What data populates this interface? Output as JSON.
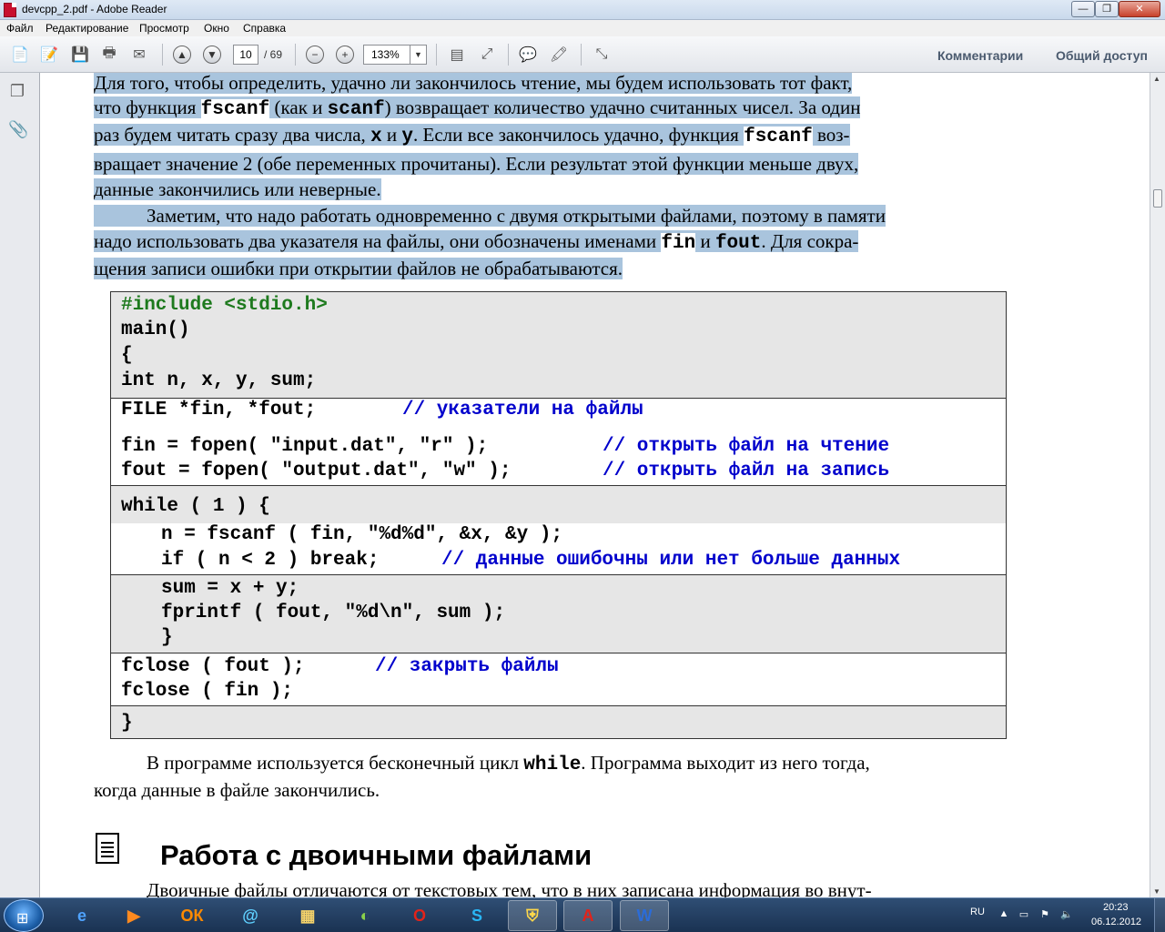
{
  "window": {
    "title": "devcpp_2.pdf - Adobe Reader"
  },
  "menu": [
    "Файл",
    "Редактирование",
    "Просмотр",
    "Окно",
    "Справка"
  ],
  "toolbar": {
    "page_current": "10",
    "page_total": "/ 69",
    "zoom": "133%",
    "comments_label": "Комментарии",
    "share_label": "Общий доступ"
  },
  "document": {
    "para1": [
      "Для того, чтобы определить, удачно ли закончилось чтение, мы будем использовать тот факт,",
      [
        "что функция ",
        "fscanf",
        " (как и ",
        "scanf",
        ") возвращает количество удачно считанных чисел. За один"
      ],
      [
        "раз будем читать сразу два числа, ",
        "x",
        " и ",
        "y",
        ". Если все закончилось удачно, функция ",
        "fscanf",
        " воз-"
      ],
      "вращает значение 2 (обе переменных прочитаны). Если результат этой функции меньше двух,",
      "данные закончились или неверные."
    ],
    "para2": [
      "Заметим, что надо работать одновременно с двумя открытыми файлами, поэтому в памяти",
      [
        "надо использовать два указателя на файлы, они обозначены именами ",
        "fin",
        " и ",
        "fout",
        ". Для сокра-"
      ],
      "щения записи ошибки при открытии файлов не обрабатываются."
    ],
    "code": {
      "include": "#include <stdio.h>",
      "main": "main()",
      "brace_open": "{",
      "decl": "int n, x, y, sum;",
      "file_decl": "FILE *fin, *fout;",
      "file_decl_comment": "// указатели на файлы",
      "fopen_in": "fin = fopen( \"input.dat\", \"r\" );",
      "fopen_in_comment": "// открыть файл на чтение",
      "fopen_out": "fout = fopen( \"output.dat\", \"w\" );",
      "fopen_out_comment": "// открыть файл на запись",
      "while": "while ( 1 ) {",
      "fscanf": "n = fscanf ( fin, \"%d%d\", &x, &y );",
      "if_break": "if ( n < 2 ) break;",
      "if_break_comment": "// данные ошибочны или нет больше данных",
      "sum": "sum = x + y;",
      "fprintf": "fprintf ( fout, \"%d\\n\", sum );",
      "while_close": "}",
      "fclose_out": "fclose ( fout );",
      "fclose_out_comment": "// закрыть файлы",
      "fclose_in": "fclose ( fin );",
      "brace_close": "}"
    },
    "para3": [
      [
        "В программе используется бесконечный цикл ",
        "while",
        ". Программа выходит из него тогда,"
      ],
      "когда данные в файле закончились."
    ],
    "heading": "Работа с двоичными файлами",
    "para4_partial": "Двоичные файлы отличаются от текстовых тем, что в них записана информация во внут-"
  },
  "taskbar": {
    "language": "RU",
    "time": "20:23",
    "date": "06.12.2012"
  }
}
